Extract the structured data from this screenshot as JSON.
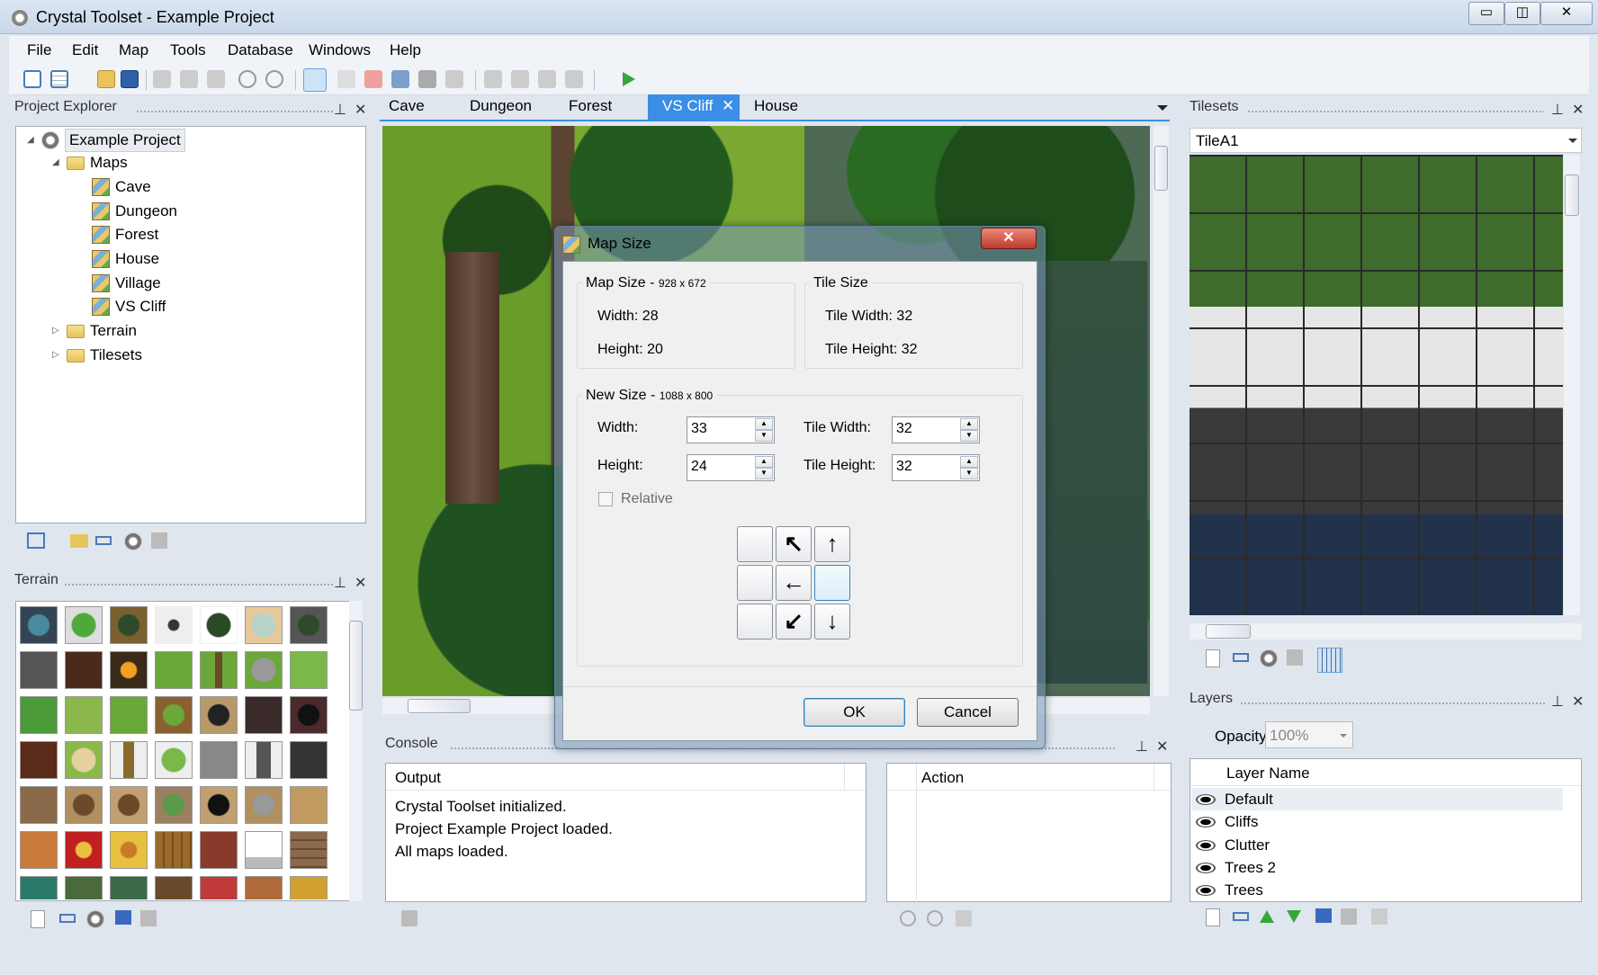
{
  "window": {
    "title": "Crystal Toolset - Example Project",
    "minimize": "▭",
    "maximize": "◫",
    "close": "✕"
  },
  "menu": [
    "File",
    "Edit",
    "Map",
    "Tools",
    "Database",
    "Windows",
    "Help"
  ],
  "project_explorer": {
    "title": "Project Explorer",
    "root": "Example Project",
    "maps_folder": "Maps",
    "maps": [
      "Cave",
      "Dungeon",
      "Forest",
      "House",
      "Village",
      "VS Cliff"
    ],
    "other_folders": [
      "Terrain",
      "Tilesets"
    ]
  },
  "terrain": {
    "title": "Terrain"
  },
  "tabs": {
    "items": [
      "Cave",
      "Dungeon",
      "Forest",
      "VS Cliff",
      "House"
    ],
    "active": "VS Cliff",
    "close": "✕"
  },
  "tilesets": {
    "title": "Tilesets",
    "selected": "TileA1"
  },
  "layers": {
    "title": "Layers",
    "opacity_label": "Opacity:",
    "opacity_value": "100%",
    "column": "Layer Name",
    "items": [
      "Default",
      "Cliffs",
      "Clutter",
      "Trees 2",
      "Trees"
    ]
  },
  "console": {
    "title": "Console",
    "output_header": "Output",
    "action_header": "Action",
    "lines": [
      "Crystal Toolset initialized.",
      "Project Example Project loaded.",
      "All maps loaded."
    ]
  },
  "dialog": {
    "title": "Map Size",
    "map_size_label": "Map Size - ",
    "map_size_px": "928 x 672",
    "width_text": "Width: 28",
    "height_text": "Height: 20",
    "tile_size_label": "Tile Size",
    "tile_width_text": "Tile Width: 32",
    "tile_height_text": "Tile Height: 32",
    "new_size_label": "New Size - ",
    "new_size_px": "1088 x 800",
    "width_label": "Width:",
    "height_label": "Height:",
    "width_value": "33",
    "height_value": "24",
    "tile_width_label": "Tile Width:",
    "tile_height_label": "Tile Height:",
    "tile_width_value": "32",
    "tile_height_value": "32",
    "relative_label": "Relative",
    "anchors": [
      "",
      "↖",
      "↑",
      "",
      "←",
      "",
      "",
      "↙",
      "↓"
    ],
    "ok": "OK",
    "cancel": "Cancel"
  }
}
